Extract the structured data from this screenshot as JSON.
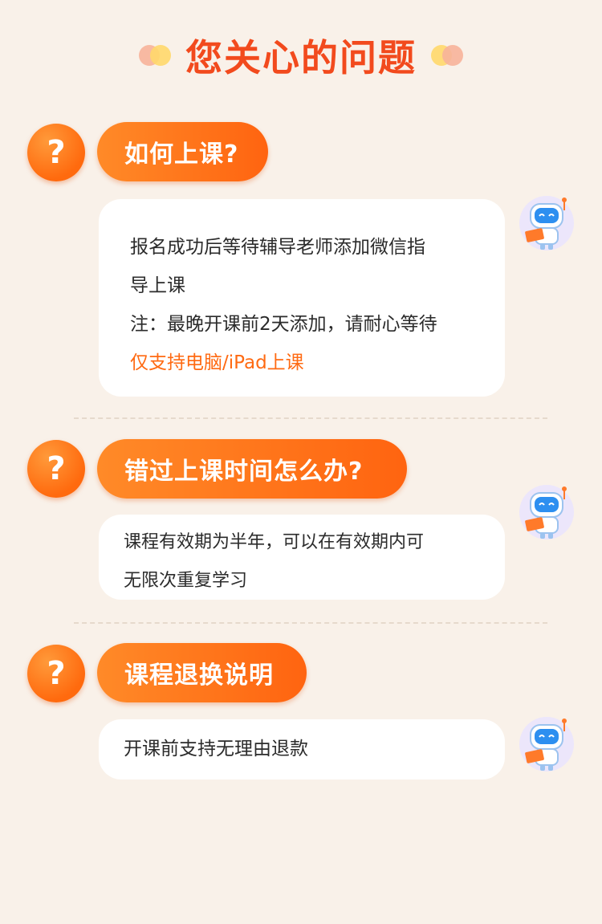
{
  "header": {
    "title": "您关心的问题"
  },
  "faq": [
    {
      "question": "如何上课?",
      "answer_lines": [
        "报名成功后等待辅导老师添加微信指",
        "导上课",
        "注：最晚开课前2天添加，请耐心等待"
      ],
      "highlight": "仅支持电脑/iPad上课"
    },
    {
      "question": "错过上课时间怎么办?",
      "answer_lines": [
        "课程有效期为半年，可以在有效期内可",
        "无限次重复学习"
      ]
    },
    {
      "question": "课程退换说明",
      "answer_lines": [
        "开课前支持无理由退款"
      ]
    }
  ],
  "question_mark": "?",
  "colors": {
    "accent": "#ff6a12",
    "title": "#f24a1d",
    "background": "#f9f1e9"
  }
}
